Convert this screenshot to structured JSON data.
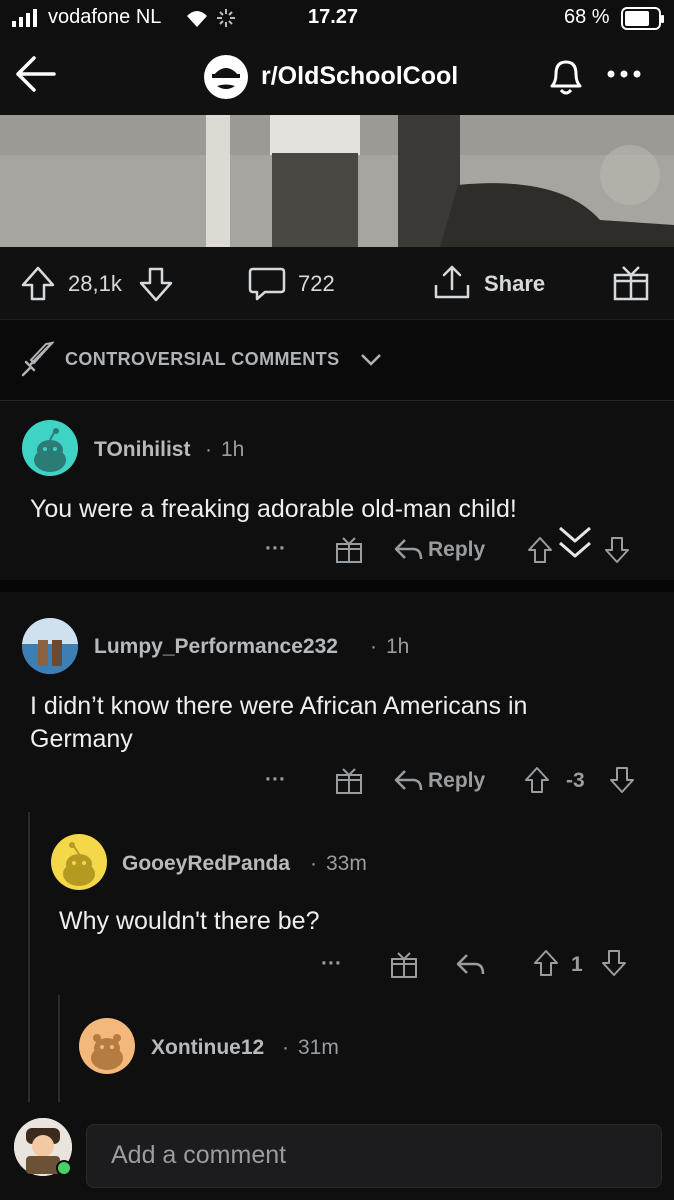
{
  "status_bar": {
    "carrier": "vodafone NL",
    "time": "17.27",
    "battery": "68 %"
  },
  "header": {
    "subreddit": "r/OldSchoolCool",
    "back_icon": "back-arrow-icon",
    "bell_icon": "bell-icon",
    "more_icon": "more-icon"
  },
  "post_actions": {
    "votes": "28,1k",
    "comments": "722",
    "share_label": "Share"
  },
  "sort": {
    "label": "CONTROVERSIAL COMMENTS"
  },
  "comments": [
    {
      "user": "TOnihilist",
      "time": "1h",
      "body": "You were a freaking adorable old-man child!",
      "reply_label": "Reply",
      "more": "···",
      "score": ""
    },
    {
      "user": "Lumpy_Performance232",
      "time": "1h",
      "body_line1": "I didn’t know there were African Americans in",
      "body_line2": "Germany",
      "reply_label": "Reply",
      "more": "···",
      "score": "-3"
    },
    {
      "user": "GooeyRedPanda",
      "time": "33m",
      "body": "Why wouldn't there be?",
      "more": "···",
      "score": "1"
    },
    {
      "user": "Xontinue12",
      "time": "31m"
    }
  ],
  "composer": {
    "placeholder": "Add a comment"
  },
  "colors": {
    "background": "#0f0f10",
    "text": "#d7dadc",
    "muted": "#9a9da0",
    "avatar_teal": "#3fd3c6",
    "avatar_yellow": "#f5d74a",
    "avatar_peach": "#f3b87a"
  }
}
